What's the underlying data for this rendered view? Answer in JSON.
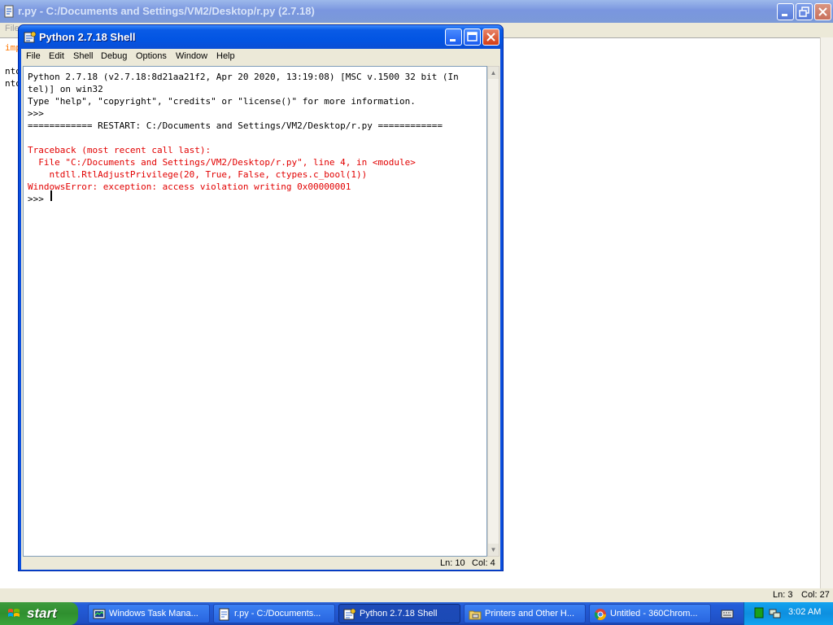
{
  "editor_window": {
    "title": "r.py - C:/Documents and Settings/VM2/Desktop/r.py (2.7.18)",
    "menu_fragment": "File",
    "code_fragments": [
      "imp",
      "",
      "nto",
      "nto"
    ],
    "status_ln": "Ln: 3",
    "status_col": "Col: 27"
  },
  "shell_window": {
    "title": "Python 2.7.18 Shell",
    "menu": [
      "File",
      "Edit",
      "Shell",
      "Debug",
      "Options",
      "Window",
      "Help"
    ],
    "lines": [
      {
        "text": "Python 2.7.18 (v2.7.18:8d21aa21f2, Apr 20 2020, 13:19:08) [MSC v.1500 32 bit (In",
        "style": "blk"
      },
      {
        "text": "tel)] on win32",
        "style": "blk"
      },
      {
        "text": "Type \"help\", \"copyright\", \"credits\" or \"license()\" for more information.",
        "style": "blk"
      },
      {
        "text": ">>> ",
        "style": "blk"
      },
      {
        "text": "============ RESTART: C:/Documents and Settings/VM2/Desktop/r.py ============",
        "style": "blk"
      },
      {
        "text": "",
        "style": "blk"
      },
      {
        "text": "Traceback (most recent call last):",
        "style": "red"
      },
      {
        "text": "  File \"C:/Documents and Settings/VM2/Desktop/r.py\", line 4, in <module>",
        "style": "red"
      },
      {
        "text": "    ntdll.RtlAdjustPrivilege(20, True, False, ctypes.c_bool(1))",
        "style": "red"
      },
      {
        "text": "WindowsError: exception: access violation writing 0x00000001",
        "style": "red"
      },
      {
        "text": ">>> ",
        "style": "blk"
      }
    ],
    "status_ln": "Ln: 10",
    "status_col": "Col: 4"
  },
  "taskbar": {
    "start_label": "start",
    "tasks": [
      {
        "label": "Windows Task Mana...",
        "icon": "task-manager-icon",
        "active": false
      },
      {
        "label": "r.py - C:/Documents...",
        "icon": "python-file-icon",
        "active": false
      },
      {
        "label": "Python 2.7.18 Shell",
        "icon": "python-shell-icon",
        "active": true
      },
      {
        "label": "Printers and Other H...",
        "icon": "printers-folder-icon",
        "active": false
      },
      {
        "label": "Untitled - 360Chrom...",
        "icon": "browser-icon",
        "active": false
      }
    ],
    "clock": "3:02 AM"
  },
  "colors": {
    "error_text": "#e20000",
    "title_active": "#0355e3",
    "title_inactive": "#7a96df",
    "start_green": "#2f8f2f"
  }
}
